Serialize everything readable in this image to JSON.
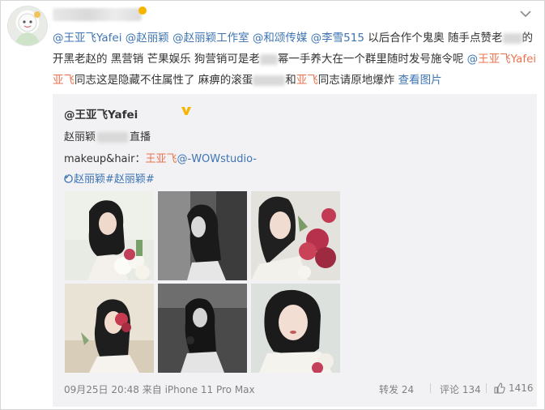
{
  "post": {
    "segments": [
      {
        "text": "@王亚飞Yafei",
        "style": "link"
      },
      {
        "text": " @赵丽颖",
        "style": "link"
      },
      {
        "text": " @赵丽颖工作室",
        "style": "link"
      },
      {
        "text": " @和颂传媒",
        "style": "link"
      },
      {
        "text": " @李雪515",
        "style": "link"
      },
      {
        "text": " 以后合作个鬼奥 随手点赞老",
        "style": "plain"
      },
      {
        "blur": 24
      },
      {
        "text": "的开黑老赵的 黑营销 芒果娱乐 狗营销可是老",
        "style": "plain"
      },
      {
        "blur": 22
      },
      {
        "text": "幂一手养大在一个群里随时发号施令呢 ",
        "style": "plain"
      },
      {
        "text": "@",
        "style": "link"
      },
      {
        "text": "王亚飞Yafei",
        "style": "mention"
      },
      {
        "text": " ",
        "style": "plain"
      },
      {
        "text": "亚飞",
        "style": "mention"
      },
      {
        "text": "同志这是隐藏不住属性了 麻痹的滚蛋",
        "style": "plain"
      },
      {
        "blur": 40
      },
      {
        "text": "和",
        "style": "plain"
      },
      {
        "text": "亚飞",
        "style": "mention"
      },
      {
        "text": "同志请原地爆炸 ",
        "style": "plain"
      },
      {
        "text": "查看图片",
        "style": "link"
      }
    ]
  },
  "repost": {
    "author": "@王亚飞Yafei",
    "line1_prefix": "赵丽颖",
    "line1_suffix": "直播",
    "line2_prefix": "makeup&hair：",
    "line2_mention": "王亚飞",
    "line2_link": "@-WOWstudio-",
    "topics": "赵丽颖#赵丽颖#",
    "photos": [
      "photo-1",
      "photo-2",
      "photo-3",
      "photo-4",
      "photo-5",
      "photo-6"
    ],
    "time": "09月25日 20:48 来自 iPhone 11 Pro Max",
    "repost_label": "转发 24",
    "comment_label": "评论 134",
    "like_count": "1416"
  },
  "colors": {
    "link": "#3e74b2",
    "mention": "#eb7350",
    "bg_repost": "#f2f2f5"
  }
}
